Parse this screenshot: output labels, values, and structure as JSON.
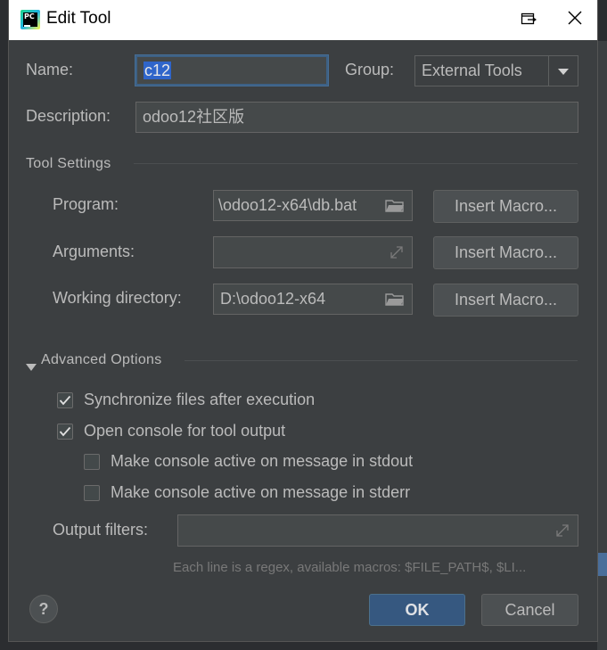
{
  "window": {
    "app_icon_text": "PC",
    "title": "Edit Tool"
  },
  "form": {
    "name_label": "Name:",
    "name_value": "c12",
    "group_label": "Group:",
    "group_value": "External Tools",
    "description_label": "Description:",
    "description_value": "odoo12社区版"
  },
  "tool_settings": {
    "section_title": "Tool Settings",
    "program_label": "Program:",
    "program_value": "\\odoo12-x64\\db.bat",
    "arguments_label": "Arguments:",
    "arguments_value": "",
    "working_dir_label": "Working directory:",
    "working_dir_value": "D:\\odoo12-x64",
    "insert_macro_label": "Insert Macro..."
  },
  "advanced": {
    "section_title": "Advanced Options",
    "options": [
      {
        "label": "Synchronize files after execution",
        "checked": true
      },
      {
        "label": "Open console for tool output",
        "checked": true
      },
      {
        "label": "Make console active on message in stdout",
        "checked": false
      },
      {
        "label": "Make console active on message in stderr",
        "checked": false
      }
    ],
    "output_filters_label": "Output filters:",
    "output_filters_value": "",
    "hint": "Each line is a regex, available macros: $FILE_PATH$, $LI..."
  },
  "footer": {
    "help_label": "?",
    "ok_label": "OK",
    "cancel_label": "Cancel"
  },
  "colors": {
    "dialog_bg": "#3c3f41",
    "field_bg": "#45494a",
    "primary_button": "#365880",
    "selection": "#2f65ca"
  },
  "icons": [
    "pycharm-app-icon",
    "restore-icon",
    "close-icon",
    "chevron-down-icon",
    "folder-icon",
    "expand-icon",
    "checkmark-icon",
    "help-icon"
  ]
}
